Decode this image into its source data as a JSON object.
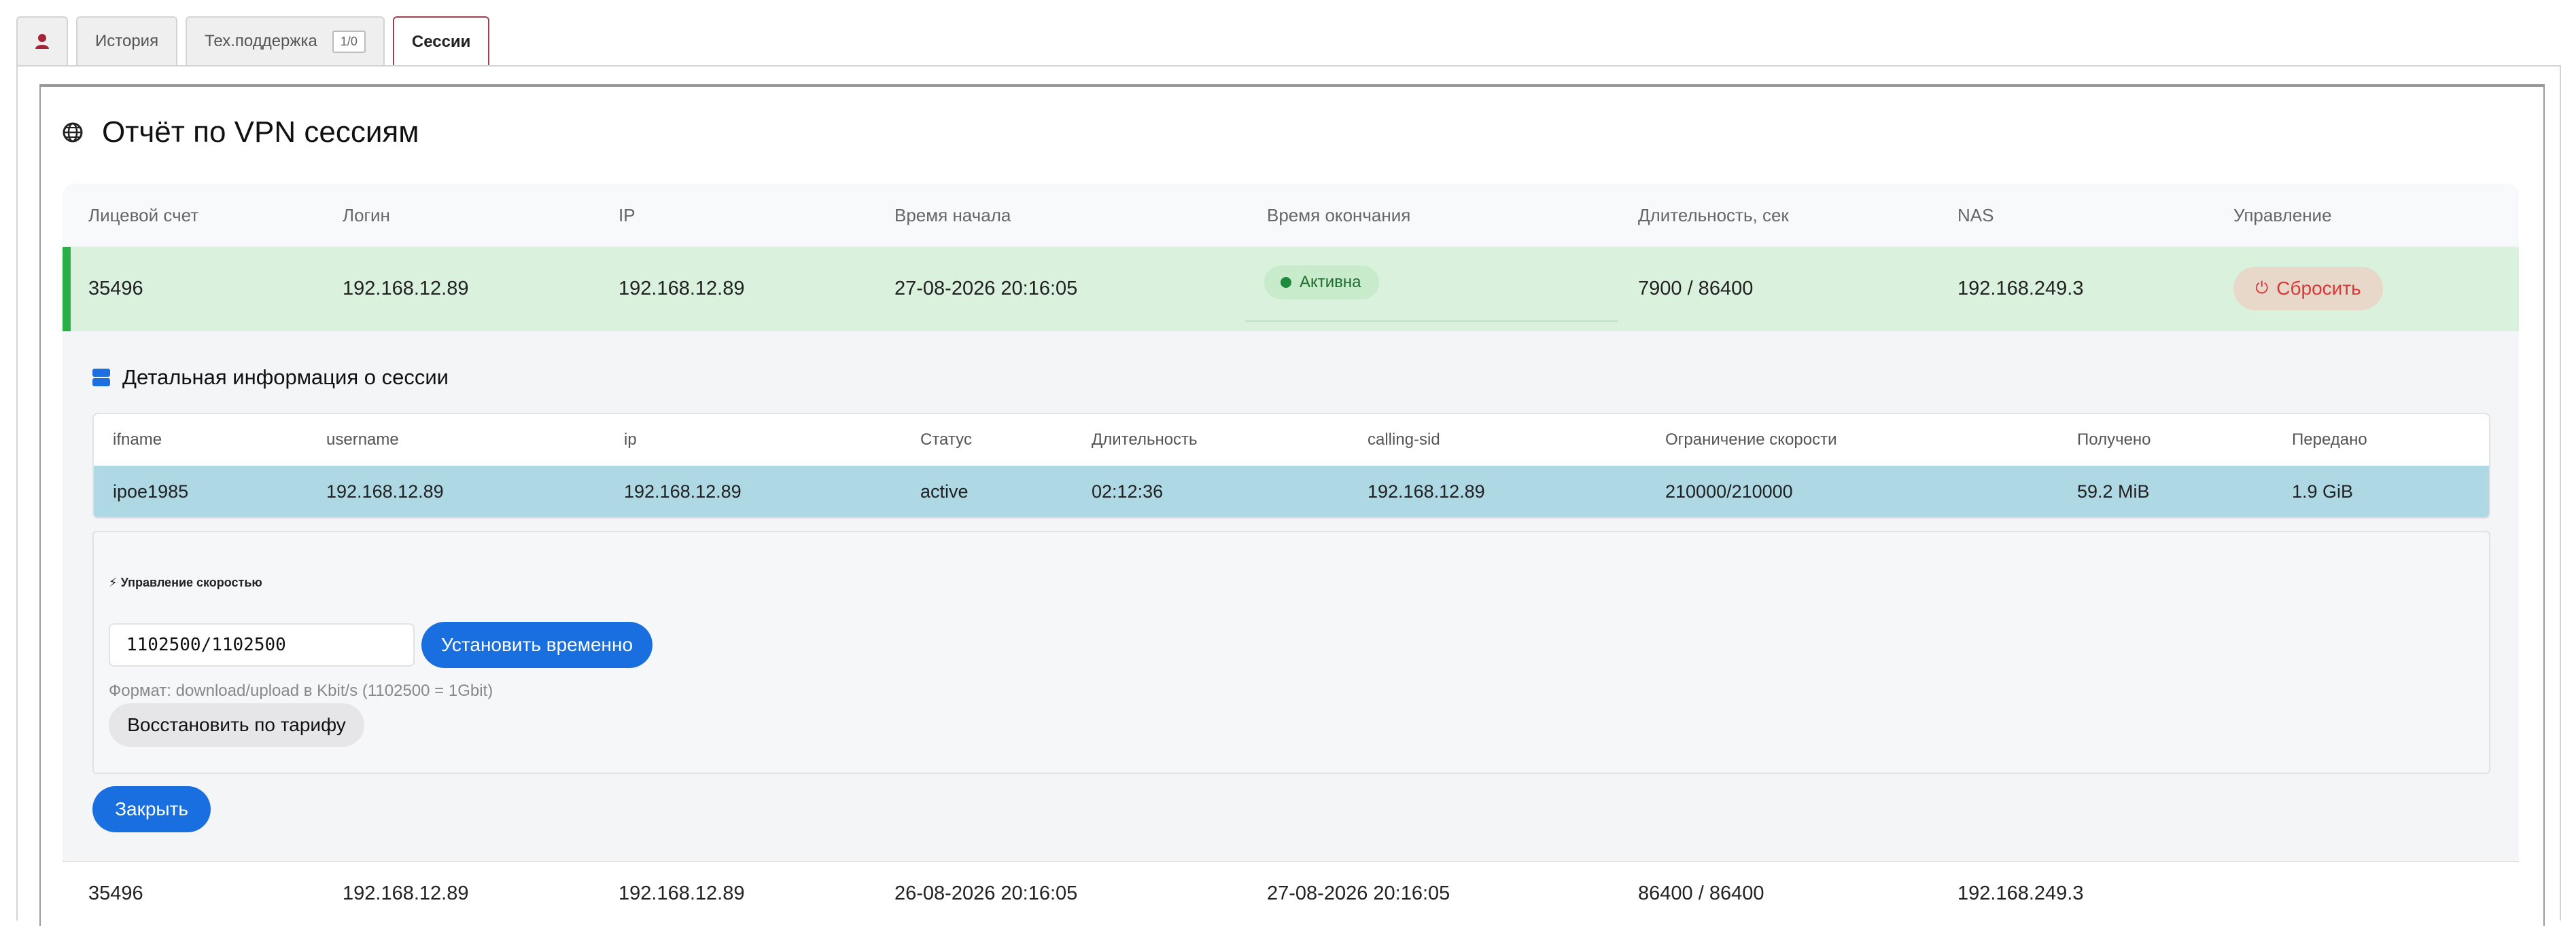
{
  "tabs": {
    "user_icon": "user-icon",
    "history": "История",
    "support": "Тех.поддержка",
    "support_badge": "1/0",
    "sessions": "Сессии"
  },
  "page": {
    "title": "Отчёт по VPN сессиям",
    "title_icon": "globe-icon"
  },
  "table": {
    "headers": [
      "Лицевой счет",
      "Логин",
      "IP",
      "Время начала",
      "Время окончания",
      "Длительность, сек",
      "NAS",
      "Управление"
    ],
    "rows": [
      {
        "account": "35496",
        "login": "192.168.12.89",
        "ip": "192.168.12.89",
        "start": "27-08-2026 20:16:05",
        "end_status": "Активна",
        "duration": "7900 / 86400",
        "nas": "192.168.249.3",
        "action": "Сбросить"
      },
      {
        "account": "35496",
        "login": "192.168.12.89",
        "ip": "192.168.12.89",
        "start": "26-08-2026 20:16:05",
        "end": "27-08-2026 20:16:05",
        "duration": "86400 / 86400",
        "nas": "192.168.249.3"
      }
    ]
  },
  "details": {
    "title": "Детальная информация о сессии",
    "headers": [
      "ifname",
      "username",
      "ip",
      "Статус",
      "Длительность",
      "calling-sid",
      "Ограничение скорости",
      "Получено",
      "Передано"
    ],
    "row": [
      "ipoe1985",
      "192.168.12.89",
      "192.168.12.89",
      "active",
      "02:12:36",
      "192.168.12.89",
      "210000/210000",
      "59.2 MiB",
      "1.9 GiB"
    ],
    "speed": {
      "title": "⚡ Управление скоростью",
      "input_value": "1102500/1102500",
      "set_temp": "Установить временно",
      "format_hint": "Формат: download/upload в Kbit/s (1102500 = 1Gbit)",
      "restore": "Восстановить по тарифу"
    },
    "close": "Закрыть"
  },
  "colors": {
    "accent": "#1a6fe0",
    "active_row": "#daf1dd",
    "active_border": "#27b045",
    "selected_row": "#aed8e3",
    "danger": "#d93838"
  }
}
